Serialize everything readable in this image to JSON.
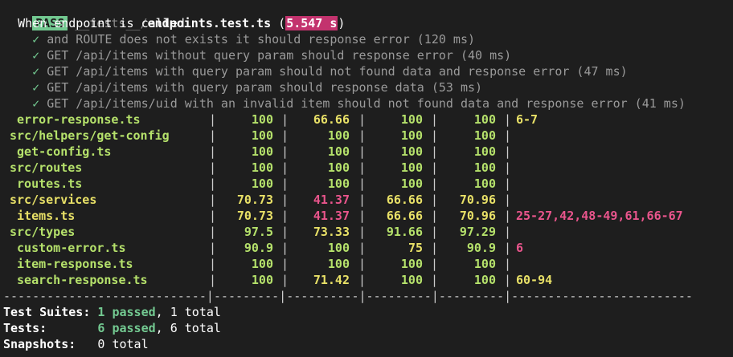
{
  "header": {
    "status": "PASS",
    "path_dir": "__tests__/",
    "file": "endpoints.test.ts",
    "open_paren": "(",
    "duration": "5.547 s",
    "close_paren": ")"
  },
  "suite": {
    "describe": "When endpoint is called",
    "check": "✓",
    "tests": [
      "and ROUTE does not exists it should response error (120 ms)",
      "GET /api/items without query param should response error (40 ms)",
      "GET /api/items with query param should not found data and response error (47 ms)",
      "GET /api/items with query param should response data (53 ms)",
      "GET /api/items/uid with an invalid item should not found data and response error (41 ms)"
    ]
  },
  "coverage": {
    "rows": [
      {
        "name": " error-response.ts",
        "stmts": "100",
        "branch": "66.66",
        "funcs": "100",
        "lines": "100",
        "uncovered": "6-7",
        "c_stmts": "good",
        "c_branch": "warn",
        "c_funcs": "good",
        "c_lines": "good",
        "c_name": "good",
        "c_unc": "warn"
      },
      {
        "name": "src/helpers/get-config",
        "stmts": "100",
        "branch": "100",
        "funcs": "100",
        "lines": "100",
        "uncovered": "",
        "c_stmts": "good",
        "c_branch": "good",
        "c_funcs": "good",
        "c_lines": "good",
        "c_name": "good",
        "c_unc": "good"
      },
      {
        "name": " get-config.ts",
        "stmts": "100",
        "branch": "100",
        "funcs": "100",
        "lines": "100",
        "uncovered": "",
        "c_stmts": "good",
        "c_branch": "good",
        "c_funcs": "good",
        "c_lines": "good",
        "c_name": "good",
        "c_unc": "good"
      },
      {
        "name": "src/routes",
        "stmts": "100",
        "branch": "100",
        "funcs": "100",
        "lines": "100",
        "uncovered": "",
        "c_stmts": "good",
        "c_branch": "good",
        "c_funcs": "good",
        "c_lines": "good",
        "c_name": "good",
        "c_unc": "good"
      },
      {
        "name": " routes.ts",
        "stmts": "100",
        "branch": "100",
        "funcs": "100",
        "lines": "100",
        "uncovered": "",
        "c_stmts": "good",
        "c_branch": "good",
        "c_funcs": "good",
        "c_lines": "good",
        "c_name": "good",
        "c_unc": "good"
      },
      {
        "name": "src/services",
        "stmts": "70.73",
        "branch": "41.37",
        "funcs": "66.66",
        "lines": "70.96",
        "uncovered": "",
        "c_stmts": "warn",
        "c_branch": "bad",
        "c_funcs": "warn",
        "c_lines": "warn",
        "c_name": "warn",
        "c_unc": "warn"
      },
      {
        "name": " items.ts",
        "stmts": "70.73",
        "branch": "41.37",
        "funcs": "66.66",
        "lines": "70.96",
        "uncovered": "25-27,42,48-49,61,66-67",
        "c_stmts": "warn",
        "c_branch": "bad",
        "c_funcs": "warn",
        "c_lines": "warn",
        "c_name": "warn",
        "c_unc": "bad"
      },
      {
        "name": "src/types",
        "stmts": "97.5",
        "branch": "73.33",
        "funcs": "91.66",
        "lines": "97.29",
        "uncovered": "",
        "c_stmts": "good",
        "c_branch": "warn",
        "c_funcs": "good",
        "c_lines": "good",
        "c_name": "good",
        "c_unc": "good"
      },
      {
        "name": " custom-error.ts",
        "stmts": "90.9",
        "branch": "100",
        "funcs": "75",
        "lines": "90.9",
        "uncovered": "6",
        "c_stmts": "good",
        "c_branch": "good",
        "c_funcs": "warn",
        "c_lines": "good",
        "c_name": "good",
        "c_unc": "bad"
      },
      {
        "name": " item-response.ts",
        "stmts": "100",
        "branch": "100",
        "funcs": "100",
        "lines": "100",
        "uncovered": "",
        "c_stmts": "good",
        "c_branch": "good",
        "c_funcs": "good",
        "c_lines": "good",
        "c_name": "good",
        "c_unc": "good"
      },
      {
        "name": " search-response.ts",
        "stmts": "100",
        "branch": "71.42",
        "funcs": "100",
        "lines": "100",
        "uncovered": "60-94",
        "c_stmts": "good",
        "c_branch": "warn",
        "c_funcs": "good",
        "c_lines": "good",
        "c_name": "good",
        "c_unc": "warn"
      }
    ],
    "separator": "----------------------------|---------|----------|---------|---------|-------------------------"
  },
  "summary": {
    "suites_label": "Test Suites: ",
    "suites_passed": "1 passed",
    "suites_total": ", 1 total",
    "tests_label": "Tests:       ",
    "tests_passed": "6 passed",
    "tests_total": ", 6 total",
    "snap_label": "Snapshots:   ",
    "snap_total": "0 total"
  }
}
